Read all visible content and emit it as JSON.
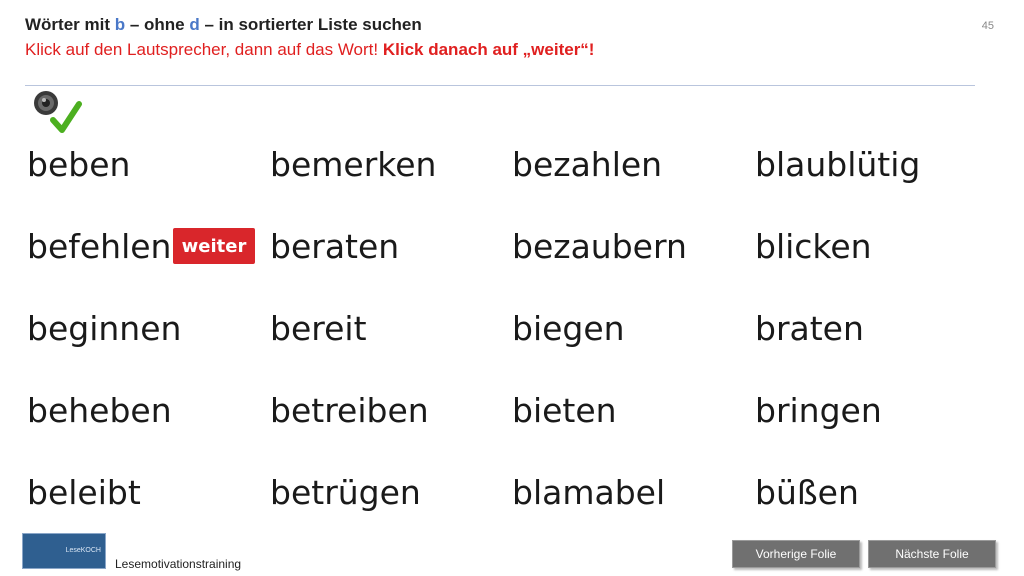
{
  "header": {
    "title_parts": [
      "Wörter mit ",
      "b",
      " – ohne ",
      "d",
      " – in sortierter Liste suchen"
    ],
    "subtitle_plain": "Klick auf den Lautsprecher, dann auf das Wort! ",
    "subtitle_bold": "Klick danach auf „weiter“!",
    "page_number": "45"
  },
  "icons": {
    "speaker": "speaker-icon",
    "check": "checkmark-icon"
  },
  "weiter_label": "weiter",
  "words": {
    "col1": [
      "beben",
      "befehlen",
      "beginnen",
      "beheben",
      "beleibt"
    ],
    "col2": [
      "bemerken",
      "beraten",
      "bereit",
      "betreiben",
      "betrügen"
    ],
    "col3": [
      "bezahlen",
      "bezaubern",
      "biegen",
      "bieten",
      "blamabel"
    ],
    "col4": [
      "blaublütig",
      "blicken",
      "braten",
      "bringen",
      "büßen"
    ]
  },
  "footer": {
    "logo_line1": "Lese",
    "logo_line2": "KOCH",
    "label": "Lesemotivationstraining",
    "prev_label": "Vorherige  Folie",
    "next_label": "Nächste  Folie"
  },
  "colors": {
    "accent_blue": "#4a78c8",
    "instruction_red": "#e02020",
    "button_red": "#d9262b",
    "nav_gray": "#707070"
  }
}
